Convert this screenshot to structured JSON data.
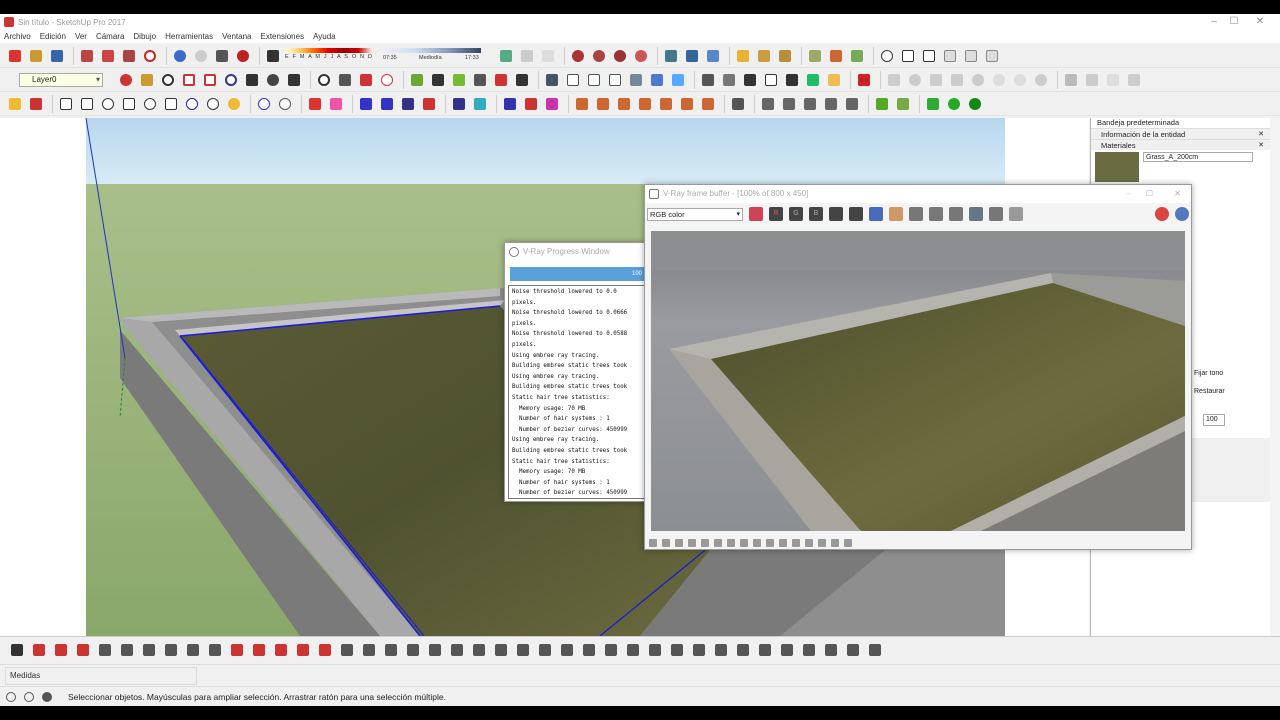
{
  "app": {
    "title": "Sin título - SketchUp Pro 2017"
  },
  "menu": [
    "Archivo",
    "Edición",
    "Ver",
    "Cámara",
    "Dibujo",
    "Herramientas",
    "Ventana",
    "Extensiones",
    "Ayuda"
  ],
  "toolbar": {
    "layer_select": "Layer0",
    "shadow_months": "E F M A M J J A S O N D",
    "shadow_time_start": "07:35",
    "shadow_time_mid": "Mediodía",
    "shadow_time_end": "17:33"
  },
  "tray": {
    "title": "Bandeja predeterminada",
    "panels": [
      "Información de la entidad",
      "Materiales"
    ],
    "material_name": "Grass_A_200cm",
    "fijar_tono": "Fijar tono",
    "restaurar": "Restaurar",
    "value": "100"
  },
  "vray_progress": {
    "title": "V-Ray Progress Window",
    "bar_label": "100",
    "log": [
      "Noise threshold lowered to 0.0",
      "pixels.",
      "Noise threshold lowered to 0.0666",
      "pixels.",
      "Noise threshold lowered to 0.0588",
      "pixels.",
      "Using embree ray tracing.",
      "Building embree static trees took",
      "Using embree ray tracing.",
      "Building embree static trees took",
      "Static hair tree statistics:",
      "  Memory usage: 70 MB",
      "  Number of hair systems : 1",
      "  Number of bezier curves: 450999",
      "Using embree ray tracing.",
      "Building embree static trees took",
      "Static hair tree statistics:",
      "  Memory usage: 70 MB",
      "  Number of hair systems : 1",
      "  Number of bezier curves: 450999"
    ]
  },
  "vfb": {
    "title": "V-Ray frame buffer - [100% of 800 x 450]",
    "channel": "RGB color",
    "btn_r": "R",
    "btn_g": "G",
    "btn_b": "B"
  },
  "measure": {
    "label": "Medidas"
  },
  "status": {
    "text": "Seleccionar objetos. Mayúsculas para ampliar selección. Arrastrar ratón para una selección múltiple."
  }
}
